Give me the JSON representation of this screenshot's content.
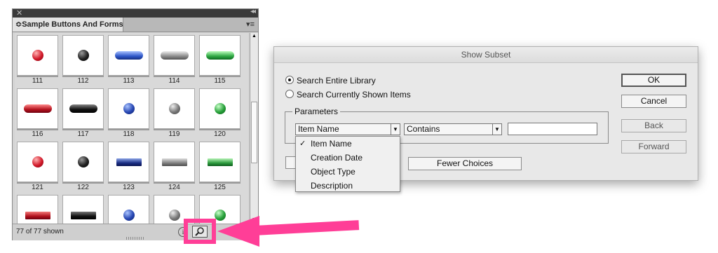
{
  "panel": {
    "close_glyph": "✕",
    "collapse_glyph": "◂◂",
    "tab_label": "≎Sample Buttons And Forms",
    "menu_glyph": "▾≡",
    "count_text": "77 of 77 shown",
    "info_glyph": "i",
    "tiles": [
      {
        "label": "111",
        "shape": "ball",
        "color": "red"
      },
      {
        "label": "112",
        "shape": "ball",
        "color": "black"
      },
      {
        "label": "113",
        "shape": "pill",
        "color": "blue"
      },
      {
        "label": "114",
        "shape": "pill",
        "color": "gray"
      },
      {
        "label": "115",
        "shape": "pill",
        "color": "green"
      },
      {
        "label": "116",
        "shape": "pill",
        "color": "red"
      },
      {
        "label": "117",
        "shape": "pill",
        "color": "black"
      },
      {
        "label": "118",
        "shape": "ball",
        "color": "blue"
      },
      {
        "label": "119",
        "shape": "ball",
        "color": "gray"
      },
      {
        "label": "120",
        "shape": "ball",
        "color": "green"
      },
      {
        "label": "121",
        "shape": "ball",
        "color": "red"
      },
      {
        "label": "122",
        "shape": "ball",
        "color": "black"
      },
      {
        "label": "123",
        "shape": "rect",
        "color": "blue"
      },
      {
        "label": "124",
        "shape": "rect",
        "color": "gray"
      },
      {
        "label": "125",
        "shape": "rect",
        "color": "green"
      },
      {
        "label": "",
        "shape": "rect",
        "color": "red"
      },
      {
        "label": "",
        "shape": "rect",
        "color": "black"
      },
      {
        "label": "",
        "shape": "ball",
        "color": "blue"
      },
      {
        "label": "",
        "shape": "ball",
        "color": "gray"
      },
      {
        "label": "",
        "shape": "ball",
        "color": "green"
      }
    ]
  },
  "highlight_color": "#ff3e97",
  "dialog": {
    "title": "Show Subset",
    "radio_entire": "Search Entire Library",
    "radio_shown": "Search Currently Shown Items",
    "parameters_legend": "Parameters",
    "field_select": "Item Name",
    "operator_select": "Contains",
    "search_value": "",
    "fewer_choices": "Fewer Choices",
    "buttons": {
      "ok": "OK",
      "cancel": "Cancel",
      "back": "Back",
      "forward": "Forward"
    },
    "dropdown_options": [
      "Item Name",
      "Creation Date",
      "Object Type",
      "Description"
    ],
    "dropdown_selected": "Item Name",
    "check_glyph": "✓"
  }
}
